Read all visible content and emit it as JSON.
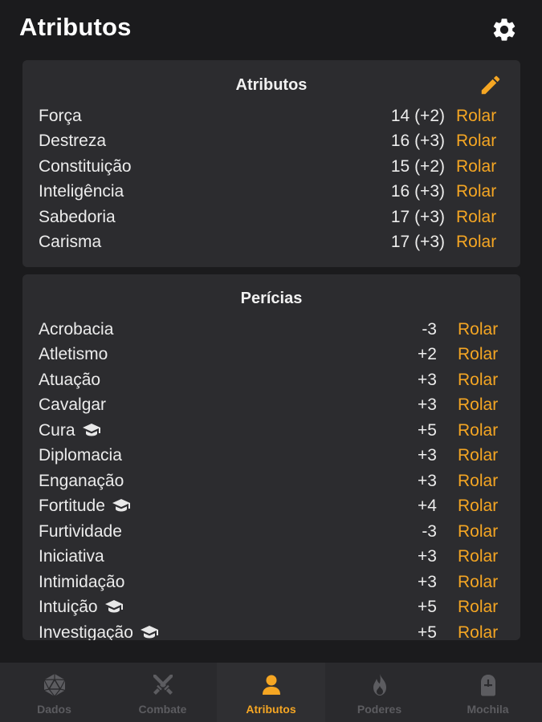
{
  "header": {
    "title": "Atributos"
  },
  "attributes": {
    "title": "Atributos",
    "rows": [
      {
        "name": "Força",
        "value": "14 (+2)",
        "roll": "Rolar"
      },
      {
        "name": "Destreza",
        "value": "16 (+3)",
        "roll": "Rolar"
      },
      {
        "name": "Constituição",
        "value": "15 (+2)",
        "roll": "Rolar"
      },
      {
        "name": "Inteligência",
        "value": "16 (+3)",
        "roll": "Rolar"
      },
      {
        "name": "Sabedoria",
        "value": "17 (+3)",
        "roll": "Rolar"
      },
      {
        "name": "Carisma",
        "value": "17 (+3)",
        "roll": "Rolar"
      }
    ]
  },
  "skills": {
    "title": "Perícias",
    "rows": [
      {
        "name": "Acrobacia",
        "value": "-3",
        "roll": "Rolar",
        "trained": false
      },
      {
        "name": "Atletismo",
        "value": "+2",
        "roll": "Rolar",
        "trained": false
      },
      {
        "name": "Atuação",
        "value": "+3",
        "roll": "Rolar",
        "trained": false
      },
      {
        "name": "Cavalgar",
        "value": "+3",
        "roll": "Rolar",
        "trained": false
      },
      {
        "name": "Cura",
        "value": "+5",
        "roll": "Rolar",
        "trained": true
      },
      {
        "name": "Diplomacia",
        "value": "+3",
        "roll": "Rolar",
        "trained": false
      },
      {
        "name": "Enganação",
        "value": "+3",
        "roll": "Rolar",
        "trained": false
      },
      {
        "name": "Fortitude",
        "value": "+4",
        "roll": "Rolar",
        "trained": true
      },
      {
        "name": "Furtividade",
        "value": "-3",
        "roll": "Rolar",
        "trained": false
      },
      {
        "name": "Iniciativa",
        "value": "+3",
        "roll": "Rolar",
        "trained": false
      },
      {
        "name": "Intimidação",
        "value": "+3",
        "roll": "Rolar",
        "trained": false
      },
      {
        "name": "Intuição",
        "value": "+5",
        "roll": "Rolar",
        "trained": true
      },
      {
        "name": "Investigação",
        "value": "+5",
        "roll": "Rolar",
        "trained": true
      }
    ]
  },
  "nav": {
    "items": [
      {
        "label": "Dados",
        "icon": "d20-dice-icon",
        "active": false
      },
      {
        "label": "Combate",
        "icon": "crossed-swords-icon",
        "active": false
      },
      {
        "label": "Atributos",
        "icon": "person-icon",
        "active": true
      },
      {
        "label": "Poderes",
        "icon": "fire-icon",
        "active": false
      },
      {
        "label": "Mochila",
        "icon": "backpack-icon",
        "active": false
      }
    ]
  },
  "colors": {
    "accent": "#f5a623",
    "background": "#1b1b1d",
    "card": "#2c2c2f",
    "nav": "#2a2a2d"
  }
}
